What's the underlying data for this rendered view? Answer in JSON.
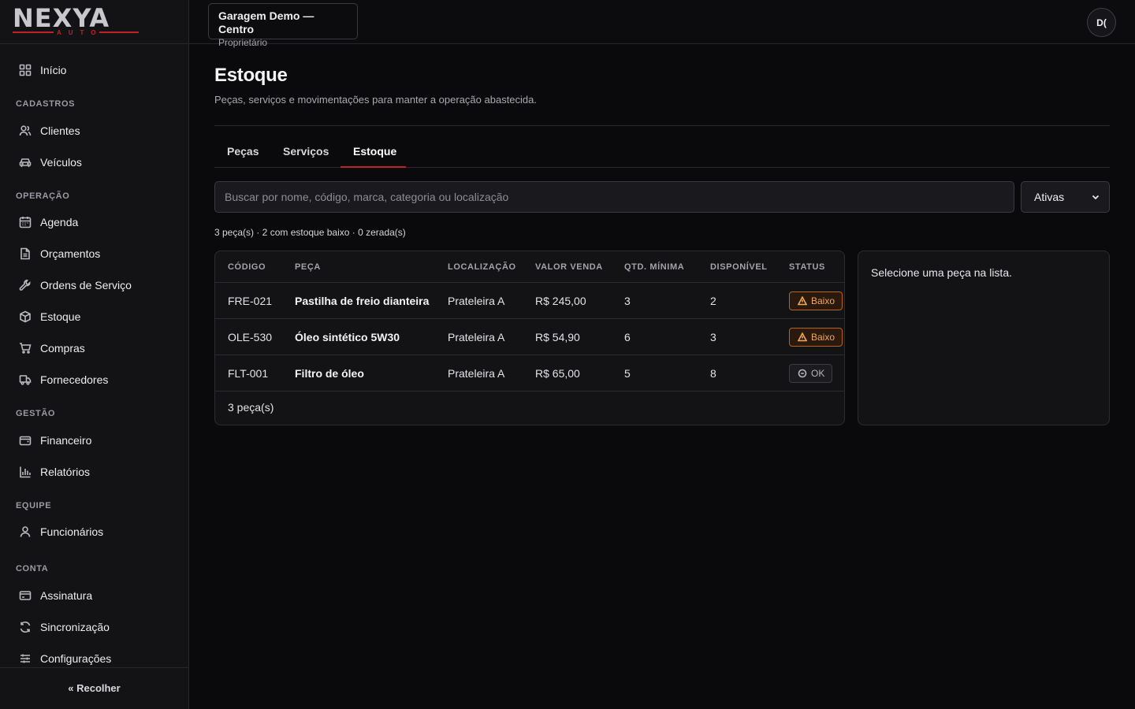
{
  "brand": {
    "name": "NEXYA",
    "sub": "AUTO",
    "accent": "#c0222a"
  },
  "workspace": {
    "name": "Garagem Demo — Centro",
    "role": "Proprietário"
  },
  "user": {
    "initials": "D("
  },
  "sidebar": {
    "home": {
      "label": "Início",
      "icon": "grid-icon"
    },
    "sections": [
      {
        "title": "CADASTROS",
        "items": [
          {
            "label": "Clientes",
            "icon": "users-icon"
          },
          {
            "label": "Veículos",
            "icon": "car-icon"
          }
        ]
      },
      {
        "title": "OPERAÇÃO",
        "items": [
          {
            "label": "Agenda",
            "icon": "calendar-icon"
          },
          {
            "label": "Orçamentos",
            "icon": "document-icon"
          },
          {
            "label": "Ordens de Serviço",
            "icon": "wrench-icon"
          },
          {
            "label": "Estoque",
            "icon": "box-icon"
          },
          {
            "label": "Compras",
            "icon": "cart-icon"
          },
          {
            "label": "Fornecedores",
            "icon": "truck-icon"
          }
        ]
      },
      {
        "title": "GESTÃO",
        "items": [
          {
            "label": "Financeiro",
            "icon": "wallet-icon"
          },
          {
            "label": "Relatórios",
            "icon": "bar-chart-icon"
          }
        ]
      },
      {
        "title": "EQUIPE",
        "items": [
          {
            "label": "Funcionários",
            "icon": "user-icon"
          }
        ]
      },
      {
        "title": "CONTA",
        "items": [
          {
            "label": "Assinatura",
            "icon": "credit-card-icon"
          },
          {
            "label": "Sincronização",
            "icon": "sync-icon"
          },
          {
            "label": "Configurações",
            "icon": "sliders-icon"
          }
        ]
      }
    ],
    "collapse_label": "« Recolher"
  },
  "page": {
    "title": "Estoque",
    "subtitle": "Peças, serviços e movimentações para manter a operação abastecida."
  },
  "tabs": [
    {
      "label": "Peças"
    },
    {
      "label": "Serviços"
    },
    {
      "label": "Estoque",
      "active": true
    }
  ],
  "search": {
    "placeholder": "Buscar por nome, código, marca, categoria ou localização",
    "value": ""
  },
  "filter": {
    "selected": "Ativas"
  },
  "summary": "3 peça(s) · 2 com estoque baixo · 0 zerada(s)",
  "table": {
    "columns": [
      "CÓDIGO",
      "PEÇA",
      "LOCALIZAÇÃO",
      "VALOR VENDA",
      "QTD. MÍNIMA",
      "DISPONÍVEL",
      "STATUS"
    ],
    "rows": [
      {
        "code": "FRE-021",
        "name": "Pastilha de freio dianteira",
        "location": "Prateleira A",
        "price": "R$ 245,00",
        "min": "3",
        "available": "2",
        "status": "Baixo",
        "status_type": "low"
      },
      {
        "code": "OLE-530",
        "name": "Óleo sintético 5W30",
        "location": "Prateleira A",
        "price": "R$ 54,90",
        "min": "6",
        "available": "3",
        "status": "Baixo",
        "status_type": "low"
      },
      {
        "code": "FLT-001",
        "name": "Filtro de óleo",
        "location": "Prateleira A",
        "price": "R$ 65,00",
        "min": "5",
        "available": "8",
        "status": "OK",
        "status_type": "ok"
      }
    ],
    "footer": "3 peça(s)"
  },
  "detail": {
    "empty_text": "Selecione uma peça na lista."
  },
  "colors": {
    "status_low": "#f3a65c",
    "status_low_border": "#b9621c",
    "status_ok": "#b6b6bd"
  }
}
